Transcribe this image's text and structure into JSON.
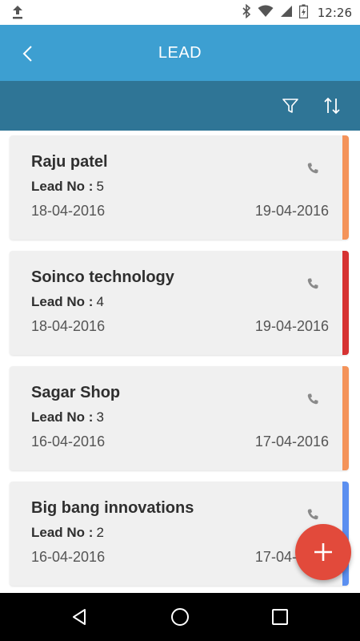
{
  "status_bar": {
    "time": "12:26"
  },
  "app_bar": {
    "title": "LEAD"
  },
  "colors": {
    "app_bar": "#3d9fd1",
    "toolbar": "#2f7596",
    "fab": "#e24a3b",
    "accent_orange": "#f4935a",
    "accent_red": "#d63232",
    "accent_blue": "#5b8ff0"
  },
  "leads": [
    {
      "name": "Raju patel",
      "lead_no_label": "Lead No :",
      "lead_no": "5",
      "start_date": "18-04-2016",
      "end_date": "19-04-2016",
      "accent": "#f4935a"
    },
    {
      "name": "Soinco technology",
      "lead_no_label": "Lead No :",
      "lead_no": "4",
      "start_date": "18-04-2016",
      "end_date": "19-04-2016",
      "accent": "#d63232"
    },
    {
      "name": "Sagar Shop",
      "lead_no_label": "Lead No :",
      "lead_no": "3",
      "start_date": "16-04-2016",
      "end_date": "17-04-2016",
      "accent": "#f4935a"
    },
    {
      "name": "Big bang innovations",
      "lead_no_label": "Lead No :",
      "lead_no": "2",
      "start_date": "16-04-2016",
      "end_date": "17-04-2016",
      "accent": "#5b8ff0"
    }
  ],
  "icons": {
    "back": "chevron-left-icon",
    "filter": "filter-icon",
    "sort": "sort-icon",
    "call": "phone-icon",
    "add": "plus-icon"
  }
}
